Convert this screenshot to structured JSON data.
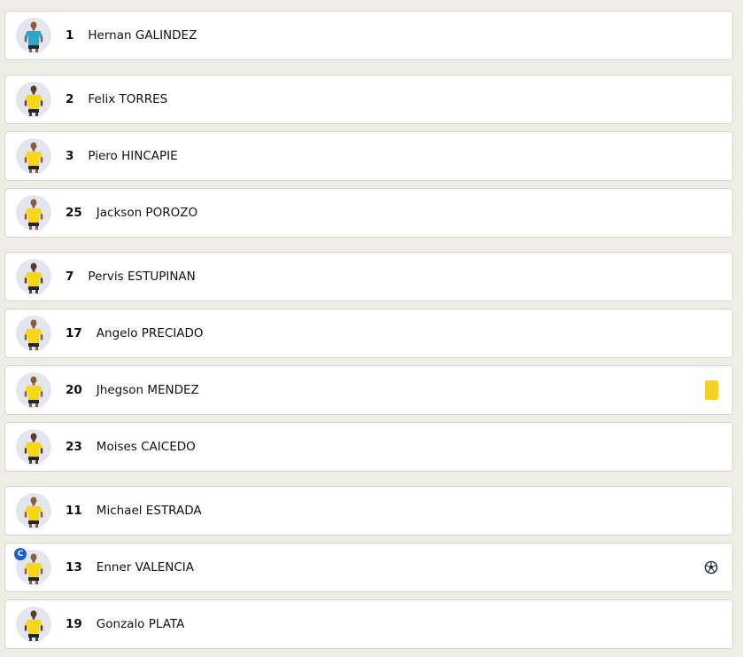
{
  "colors": {
    "background": "#efeee6",
    "row_bg": "#ffffff",
    "row_border": "#d9d9d2",
    "kit_home": "#f5d716",
    "kit_goalkeeper": "#2aa7c9",
    "yellow_card": "#f4d125",
    "captain_badge": "#1a5fd0"
  },
  "players": [
    {
      "number": "1",
      "name": "Hernan GALINDEZ",
      "kit": "goalkeeper",
      "captain": false,
      "event": null
    },
    {
      "number": "2",
      "name": "Felix TORRES",
      "kit": "home",
      "captain": false,
      "event": null
    },
    {
      "number": "3",
      "name": "Piero HINCAPIE",
      "kit": "home",
      "captain": false,
      "event": null
    },
    {
      "number": "25",
      "name": "Jackson POROZO",
      "kit": "home",
      "captain": false,
      "event": null
    },
    {
      "number": "7",
      "name": "Pervis ESTUPINAN",
      "kit": "home",
      "captain": false,
      "event": null
    },
    {
      "number": "17",
      "name": "Angelo PRECIADO",
      "kit": "home",
      "captain": false,
      "event": null
    },
    {
      "number": "20",
      "name": "Jhegson MENDEZ",
      "kit": "home",
      "captain": false,
      "event": "yellow-card-icon"
    },
    {
      "number": "23",
      "name": "Moises CAICEDO",
      "kit": "home",
      "captain": false,
      "event": null
    },
    {
      "number": "11",
      "name": "Michael ESTRADA",
      "kit": "home",
      "captain": false,
      "event": null
    },
    {
      "number": "13",
      "name": "Enner VALENCIA",
      "kit": "home",
      "captain": true,
      "captain_label": "C",
      "event": "goal-ball-icon"
    },
    {
      "number": "19",
      "name": "Gonzalo PLATA",
      "kit": "home",
      "captain": false,
      "event": null
    }
  ]
}
